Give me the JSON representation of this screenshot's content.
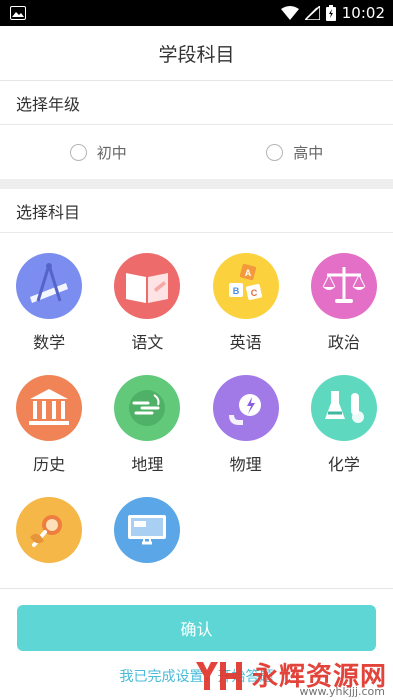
{
  "status_bar": {
    "time": "10:02"
  },
  "header": {
    "title": "学段科目"
  },
  "grade_section": {
    "heading": "选择年级",
    "options": [
      {
        "label": "初中",
        "selected": false
      },
      {
        "label": "高中",
        "selected": false
      }
    ]
  },
  "subject_section": {
    "heading": "选择科目",
    "subjects": [
      {
        "label": "数学",
        "icon": "math-tools-icon",
        "color": "#7b8ef0"
      },
      {
        "label": "语文",
        "icon": "open-book-icon",
        "color": "#ee6b6b"
      },
      {
        "label": "英语",
        "icon": "abc-blocks-icon",
        "color": "#fbd23e"
      },
      {
        "label": "政治",
        "icon": "balance-scale-icon",
        "color": "#e46fc7"
      },
      {
        "label": "历史",
        "icon": "ancient-building-icon",
        "color": "#f08457"
      },
      {
        "label": "地理",
        "icon": "globe-icon",
        "color": "#62c97a"
      },
      {
        "label": "物理",
        "icon": "physics-magnet-icon",
        "color": "#a17ae8"
      },
      {
        "label": "化学",
        "icon": "lab-flask-icon",
        "color": "#5fd8c0"
      },
      {
        "label": "",
        "icon": "magnifier-leaf-icon",
        "color": "#f4b748"
      },
      {
        "label": "",
        "icon": "computer-icon",
        "color": "#5aa6e6"
      }
    ]
  },
  "footer": {
    "confirm_label": "确认",
    "link_text": "我已完成设置，开始答题"
  },
  "watermark": {
    "text": "永辉资源网",
    "url": "www.yhkjjj.com"
  }
}
